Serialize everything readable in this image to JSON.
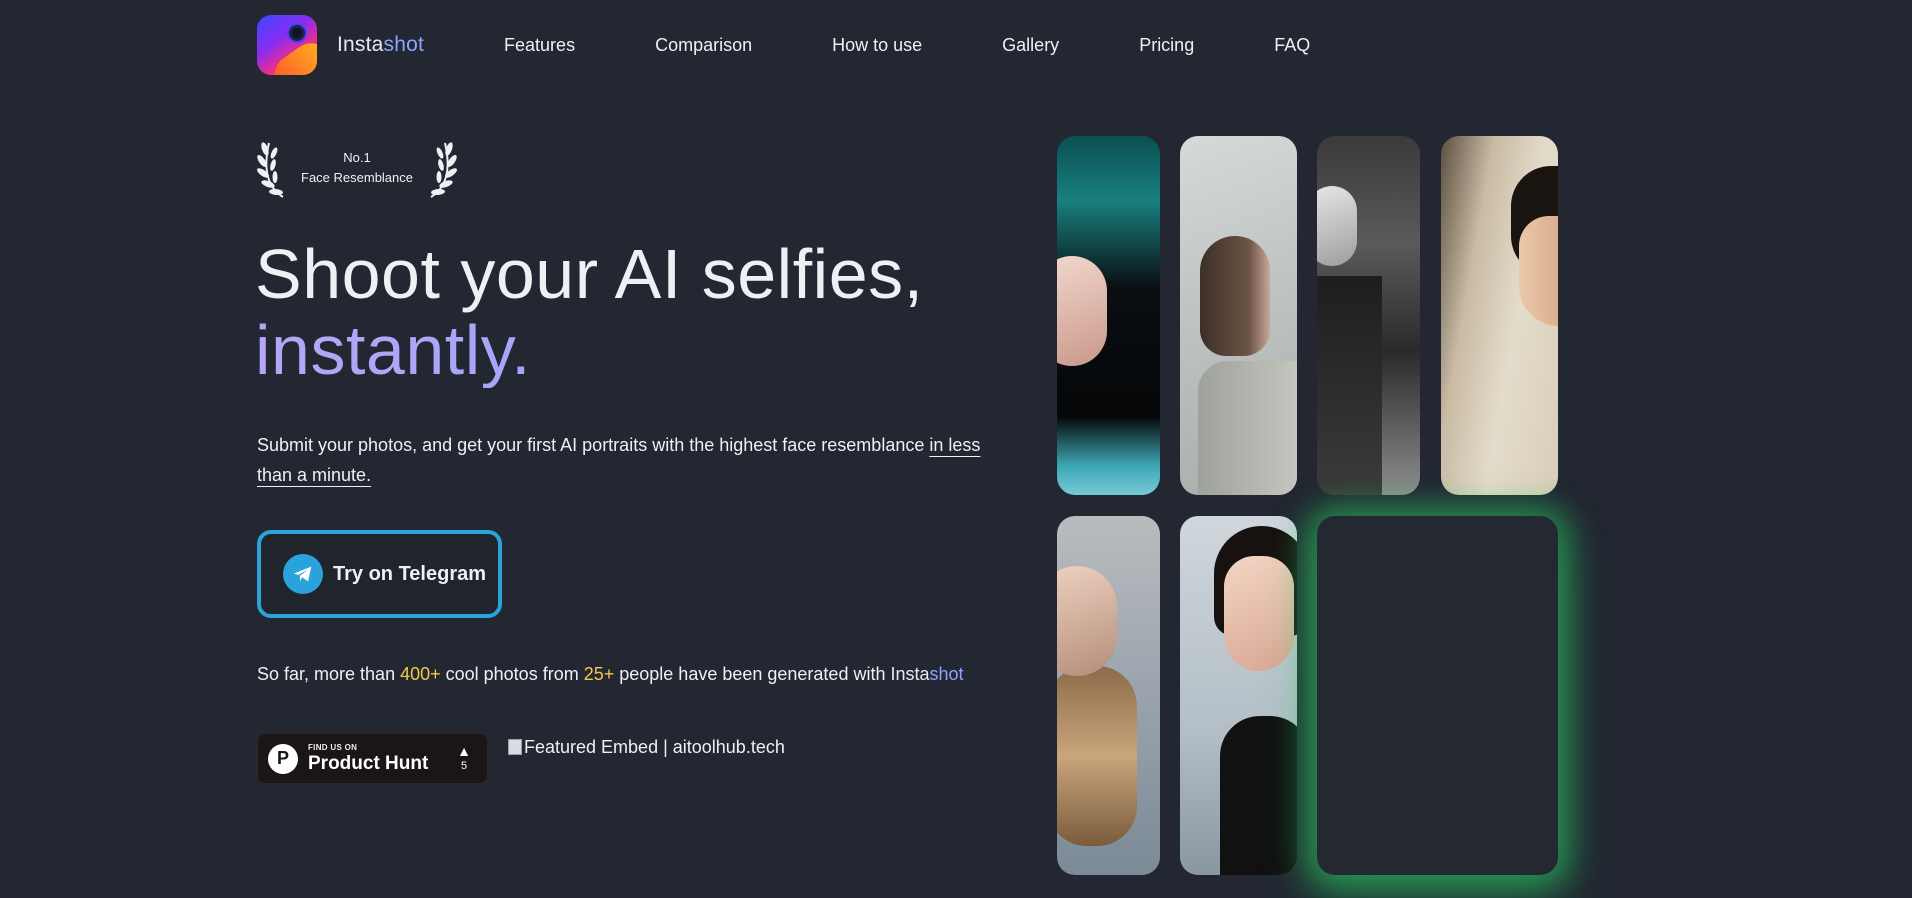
{
  "nav": {
    "brand_prefix": "Insta",
    "brand_accent": "shot",
    "links": [
      "Features",
      "Comparison",
      "How to use",
      "Gallery",
      "Pricing",
      "FAQ"
    ]
  },
  "award": {
    "line1": "No.1",
    "line2": "Face Resemblance"
  },
  "hero": {
    "headline_line1": "Shoot your AI selfies,",
    "headline_line2": "instantly.",
    "sub_text": "Submit your photos, and get your first AI portraits with the highest face resemblance ",
    "sub_underlined": "in less than a minute."
  },
  "cta": {
    "telegram_label": "Try on Telegram"
  },
  "stats": {
    "prefix": "So far, more than ",
    "photos": "400+",
    "middle": " cool photos from ",
    "people": "25+",
    "suffix": " people have been generated with "
  },
  "product_hunt": {
    "small": "FIND US ON",
    "big": "Product Hunt",
    "votes": "5",
    "logo_letter": "P"
  },
  "featured": {
    "alt_text": "Featured Embed | aitoolhub.tech"
  },
  "colors": {
    "background": "#222731",
    "accent_purple": "#9aa8f2",
    "telegram_blue": "#2aa3dd",
    "highlight_yellow": "#f5c84a",
    "glow_green": "#28c864"
  },
  "icons": {
    "telegram": "telegram-plane-icon",
    "laurel": "laurel-wreath-icon",
    "vote": "upvote-triangle-icon"
  }
}
